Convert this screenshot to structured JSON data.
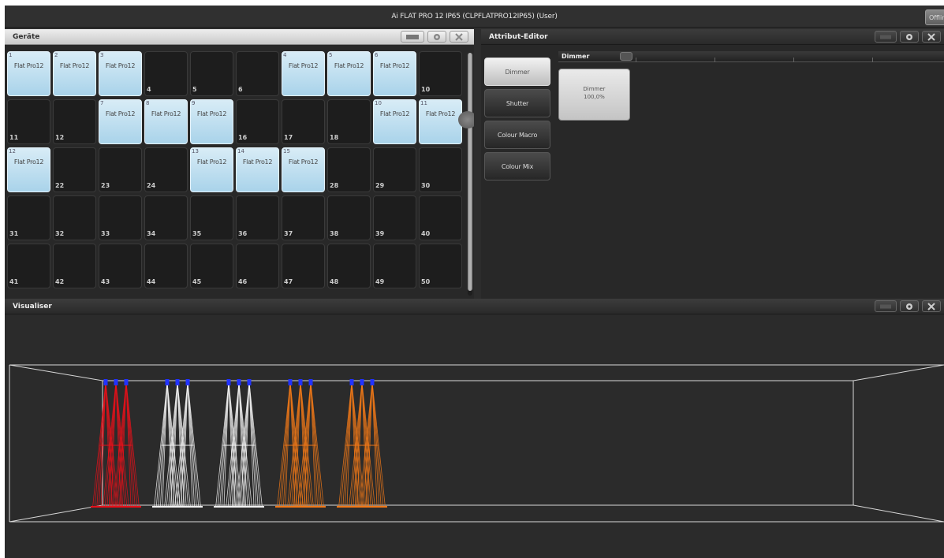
{
  "app": {
    "title": "Ai FLAT PRO 12 IP65 (CLPFLATPRO12IP65) (User)",
    "offline_label": "Offline"
  },
  "fixtures_window": {
    "title": "Geräte",
    "cells": [
      {
        "n": "1",
        "label": "Flat Pro12"
      },
      {
        "n": "2",
        "label": "Flat Pro12"
      },
      {
        "n": "3",
        "label": "Flat Pro12"
      },
      {
        "n": "4"
      },
      {
        "n": "5"
      },
      {
        "n": "6"
      },
      {
        "n": "4",
        "label": "Flat Pro12"
      },
      {
        "n": "5",
        "label": "Flat Pro12"
      },
      {
        "n": "6",
        "label": "Flat Pro12"
      },
      {
        "n": "10"
      },
      {
        "n": "11"
      },
      {
        "n": "12"
      },
      {
        "n": "7",
        "label": "Flat Pro12"
      },
      {
        "n": "8",
        "label": "Flat Pro12"
      },
      {
        "n": "9",
        "label": "Flat Pro12"
      },
      {
        "n": "16"
      },
      {
        "n": "17"
      },
      {
        "n": "18"
      },
      {
        "n": "10",
        "label": "Flat Pro12"
      },
      {
        "n": "11",
        "label": "Flat Pro12"
      },
      {
        "n": "12",
        "label": "Flat Pro12"
      },
      {
        "n": "22"
      },
      {
        "n": "23"
      },
      {
        "n": "24"
      },
      {
        "n": "13",
        "label": "Flat Pro12"
      },
      {
        "n": "14",
        "label": "Flat Pro12"
      },
      {
        "n": "15",
        "label": "Flat Pro12"
      },
      {
        "n": "28"
      },
      {
        "n": "29"
      },
      {
        "n": "30"
      },
      {
        "n": "31"
      },
      {
        "n": "32"
      },
      {
        "n": "33"
      },
      {
        "n": "34"
      },
      {
        "n": "35"
      },
      {
        "n": "36"
      },
      {
        "n": "37"
      },
      {
        "n": "38"
      },
      {
        "n": "39"
      },
      {
        "n": "40"
      },
      {
        "n": "41"
      },
      {
        "n": "42"
      },
      {
        "n": "43"
      },
      {
        "n": "44"
      },
      {
        "n": "45"
      },
      {
        "n": "46"
      },
      {
        "n": "47"
      },
      {
        "n": "48"
      },
      {
        "n": "49"
      },
      {
        "n": "50"
      }
    ]
  },
  "attribute_editor": {
    "title": "Attribut-Editor",
    "buttons": [
      {
        "label": "Dimmer",
        "selected": true
      },
      {
        "label": "Shutter",
        "selected": false
      },
      {
        "label": "Colour Macro",
        "selected": false
      },
      {
        "label": "Colour Mix",
        "selected": false
      }
    ],
    "bar_label": "Dimmer",
    "tile_name": "Dimmer",
    "tile_value": "100,0%"
  },
  "visualiser": {
    "title": "Visualiser",
    "beam_groups": [
      {
        "color": "#e8101a"
      },
      {
        "color": "#f2f2f2"
      },
      {
        "color": "#f2f2f2"
      },
      {
        "color": "#f07818"
      },
      {
        "color": "#f07818"
      }
    ],
    "lamp_color": "#2233ff"
  }
}
